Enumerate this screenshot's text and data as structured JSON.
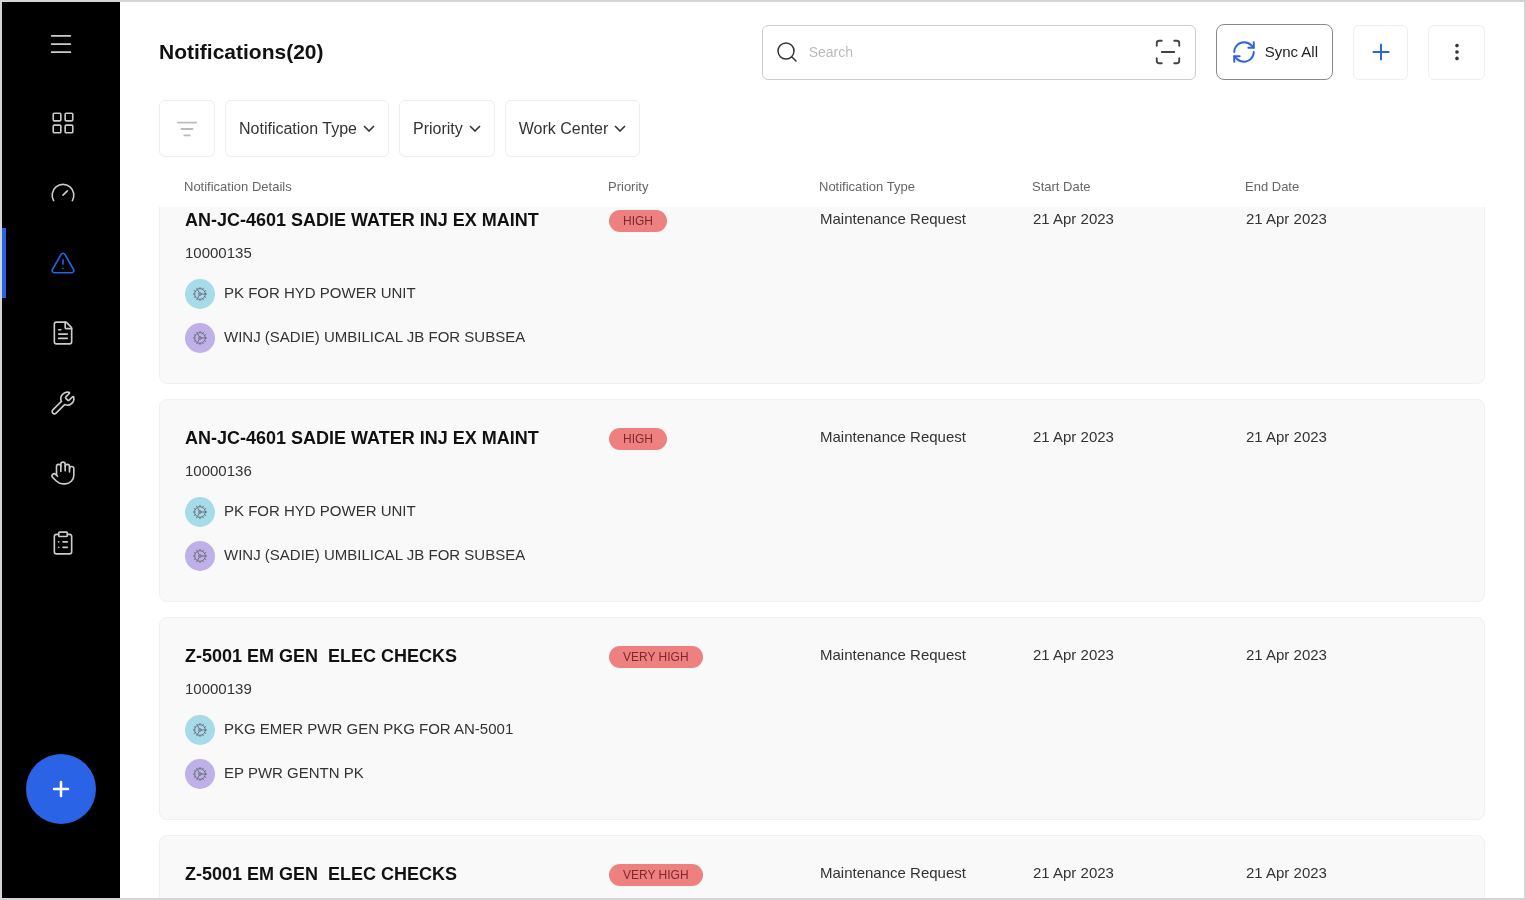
{
  "sidebar": {
    "items": [
      {
        "selected": false
      },
      {
        "selected": false
      },
      {
        "selected": true
      },
      {
        "selected": false
      },
      {
        "selected": false
      },
      {
        "selected": false
      },
      {
        "selected": false
      }
    ]
  },
  "header": {
    "title": "Notifications(20)",
    "search": {
      "placeholder": "Search"
    },
    "sync_button": "Sync All"
  },
  "filters": [
    "Notification Type",
    "Priority",
    "Work Center"
  ],
  "table": {
    "columns": [
      "Notification Details",
      "Priority",
      "Notification Type",
      "Start Date",
      "End Date"
    ],
    "rows": [
      {
        "title": "AN-JC-4601 SADIE WATER INJ EX MAINT",
        "number": "10000135",
        "priority": "HIGH",
        "type": "Maintenance Request",
        "start": "21 Apr 2023",
        "end": "21 Apr 2023",
        "links": [
          {
            "text": "PK FOR HYD POWER UNIT",
            "color": "#a6dbe8"
          },
          {
            "text": "WINJ (SADIE) UMBILICAL JB FOR SUBSEA",
            "color": "#bfb0e8"
          }
        ]
      },
      {
        "title": "AN-JC-4601 SADIE WATER INJ EX MAINT",
        "number": "10000136",
        "priority": "HIGH",
        "type": "Maintenance Request",
        "start": "21 Apr 2023",
        "end": "21 Apr 2023",
        "links": [
          {
            "text": "PK FOR HYD POWER UNIT",
            "color": "#a6dbe8"
          },
          {
            "text": "WINJ (SADIE) UMBILICAL JB FOR SUBSEA",
            "color": "#bfb0e8"
          }
        ]
      },
      {
        "title": "Z-5001 EM GEN  ELEC CHECKS",
        "number": "10000139",
        "priority": "VERY HIGH",
        "type": "Maintenance Request",
        "start": "21 Apr 2023",
        "end": "21 Apr 2023",
        "links": [
          {
            "text": "PKG EMER PWR GEN PKG FOR AN-5001",
            "color": "#a6dbe8"
          },
          {
            "text": "EP PWR GENTN PK",
            "color": "#bfb0e8"
          }
        ]
      },
      {
        "title": "Z-5001 EM GEN  ELEC CHECKS",
        "priority": "VERY HIGH",
        "type": "Maintenance Request",
        "start": "21 Apr 2023",
        "end": "21 Apr 2023"
      }
    ]
  }
}
